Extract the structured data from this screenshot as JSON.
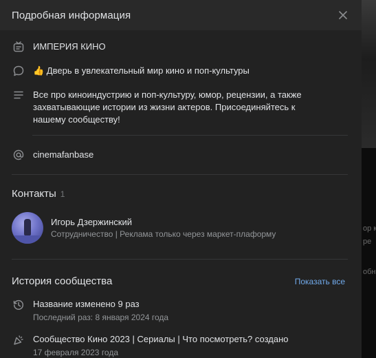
{
  "modal": {
    "title": "Подробная информация"
  },
  "info": {
    "name": "ИМПЕРИЯ КИНО",
    "slogan": "👍 Дверь в увлекательный мир кино и поп-культуры",
    "description": "Все про киноиндустрию и поп-культуру, юмор, рецензии, а также захватывающие истории из жизни актеров. Присоединяйтесь к нашему сообществу!",
    "address": "cinemafanbase"
  },
  "contacts": {
    "title": "Контакты",
    "count": "1",
    "items": [
      {
        "name": "Игорь Дзержинский",
        "role": "Сотрудничество | Реклама только через маркет-плаформу"
      }
    ]
  },
  "history": {
    "title": "История сообщества",
    "show_all": "Показать все",
    "items": [
      {
        "main": "Название изменено 9 раз",
        "sub": "Последний раз: 8 января 2024 года",
        "icon": "history-icon"
      },
      {
        "main": "Сообщество Кино 2023 | Сериалы | Что посмотреть? создано",
        "sub": "17 февраля 2023 года",
        "icon": "party-icon"
      }
    ]
  },
  "background": {
    "snippets": [
      "ор к",
      "ре",
      "обна"
    ]
  },
  "colors": {
    "modal_bg": "#222222",
    "header_bg": "#292929",
    "accent_link": "#71aaeb",
    "secondary_text": "#939699"
  }
}
